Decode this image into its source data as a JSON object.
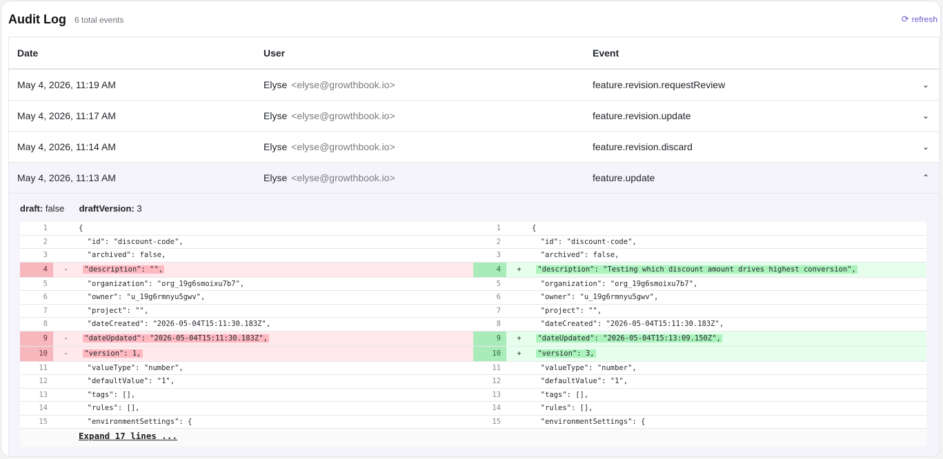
{
  "header": {
    "title": "Audit Log",
    "count": "6 total events",
    "refresh_label": "refresh",
    "refresh_icon": "refresh-icon"
  },
  "columns": {
    "date": "Date",
    "user": "User",
    "event": "Event"
  },
  "rows": [
    {
      "date": "May 4, 2026, 11:19 AM",
      "name": "Elyse",
      "email": "<elyse@growthbook.io>",
      "event": "feature.revision.requestReview",
      "chevron": "⌄"
    },
    {
      "date": "May 4, 2026, 11:17 AM",
      "name": "Elyse",
      "email": "<elyse@growthbook.io>",
      "event": "feature.revision.update",
      "chevron": "⌄"
    },
    {
      "date": "May 4, 2026, 11:14 AM",
      "name": "Elyse",
      "email": "<elyse@growthbook.io>",
      "event": "feature.revision.discard",
      "chevron": "⌄"
    },
    {
      "date": "May 4, 2026, 11:13 AM",
      "name": "Elyse",
      "email": "<elyse@growthbook.io>",
      "event": "feature.update",
      "chevron": "⌃"
    }
  ],
  "detail": {
    "draft_label": "draft:",
    "draft_value": "false",
    "draft_version_label": "draftVersion:",
    "draft_version_value": "3",
    "expand_label": "Expand 17 lines ..."
  },
  "diff": [
    {
      "l": "1",
      "lm": "",
      "lc": "{",
      "r": "1",
      "rm": "",
      "rc": "{",
      "type": ""
    },
    {
      "l": "2",
      "lm": "",
      "lc": "  \"id\": \"discount-code\",",
      "r": "2",
      "rm": "",
      "rc": "  \"id\": \"discount-code\",",
      "type": ""
    },
    {
      "l": "3",
      "lm": "",
      "lc": "  \"archived\": false,",
      "r": "3",
      "rm": "",
      "rc": "  \"archived\": false,",
      "type": ""
    },
    {
      "l": "4",
      "lm": "-",
      "lc": "\"description\": \"\",",
      "r": "4",
      "rm": "+",
      "rc": "\"description\": \"Testing which discount amount drives highest conversion\",",
      "type": "change"
    },
    {
      "l": "5",
      "lm": "",
      "lc": "  \"organization\": \"org_19g6smoixu7b7\",",
      "r": "5",
      "rm": "",
      "rc": "  \"organization\": \"org_19g6smoixu7b7\",",
      "type": ""
    },
    {
      "l": "6",
      "lm": "",
      "lc": "  \"owner\": \"u_19g6rmnyu5gwv\",",
      "r": "6",
      "rm": "",
      "rc": "  \"owner\": \"u_19g6rmnyu5gwv\",",
      "type": ""
    },
    {
      "l": "7",
      "lm": "",
      "lc": "  \"project\": \"\",",
      "r": "7",
      "rm": "",
      "rc": "  \"project\": \"\",",
      "type": ""
    },
    {
      "l": "8",
      "lm": "",
      "lc": "  \"dateCreated\": \"2026-05-04T15:11:30.183Z\",",
      "r": "8",
      "rm": "",
      "rc": "  \"dateCreated\": \"2026-05-04T15:11:30.183Z\",",
      "type": ""
    },
    {
      "l": "9",
      "lm": "-",
      "lc": "\"dateUpdated\": \"2026-05-04T15:11:30.183Z\",",
      "r": "9",
      "rm": "+",
      "rc": "\"dateUpdated\": \"2026-05-04T15:13:09.150Z\",",
      "type": "change"
    },
    {
      "l": "10",
      "lm": "-",
      "lc": "\"version\": 1,",
      "r": "10",
      "rm": "+",
      "rc": "\"version\": 3,",
      "type": "change"
    },
    {
      "l": "11",
      "lm": "",
      "lc": "  \"valueType\": \"number\",",
      "r": "11",
      "rm": "",
      "rc": "  \"valueType\": \"number\",",
      "type": ""
    },
    {
      "l": "12",
      "lm": "",
      "lc": "  \"defaultValue\": \"1\",",
      "r": "12",
      "rm": "",
      "rc": "  \"defaultValue\": \"1\",",
      "type": ""
    },
    {
      "l": "13",
      "lm": "",
      "lc": "  \"tags\": [],",
      "r": "13",
      "rm": "",
      "rc": "  \"tags\": [],",
      "type": ""
    },
    {
      "l": "14",
      "lm": "",
      "lc": "  \"rules\": [],",
      "r": "14",
      "rm": "",
      "rc": "  \"rules\": [],",
      "type": ""
    },
    {
      "l": "15",
      "lm": "",
      "lc": "  \"environmentSettings\": {",
      "r": "15",
      "rm": "",
      "rc": "  \"environmentSettings\": {",
      "type": ""
    }
  ]
}
